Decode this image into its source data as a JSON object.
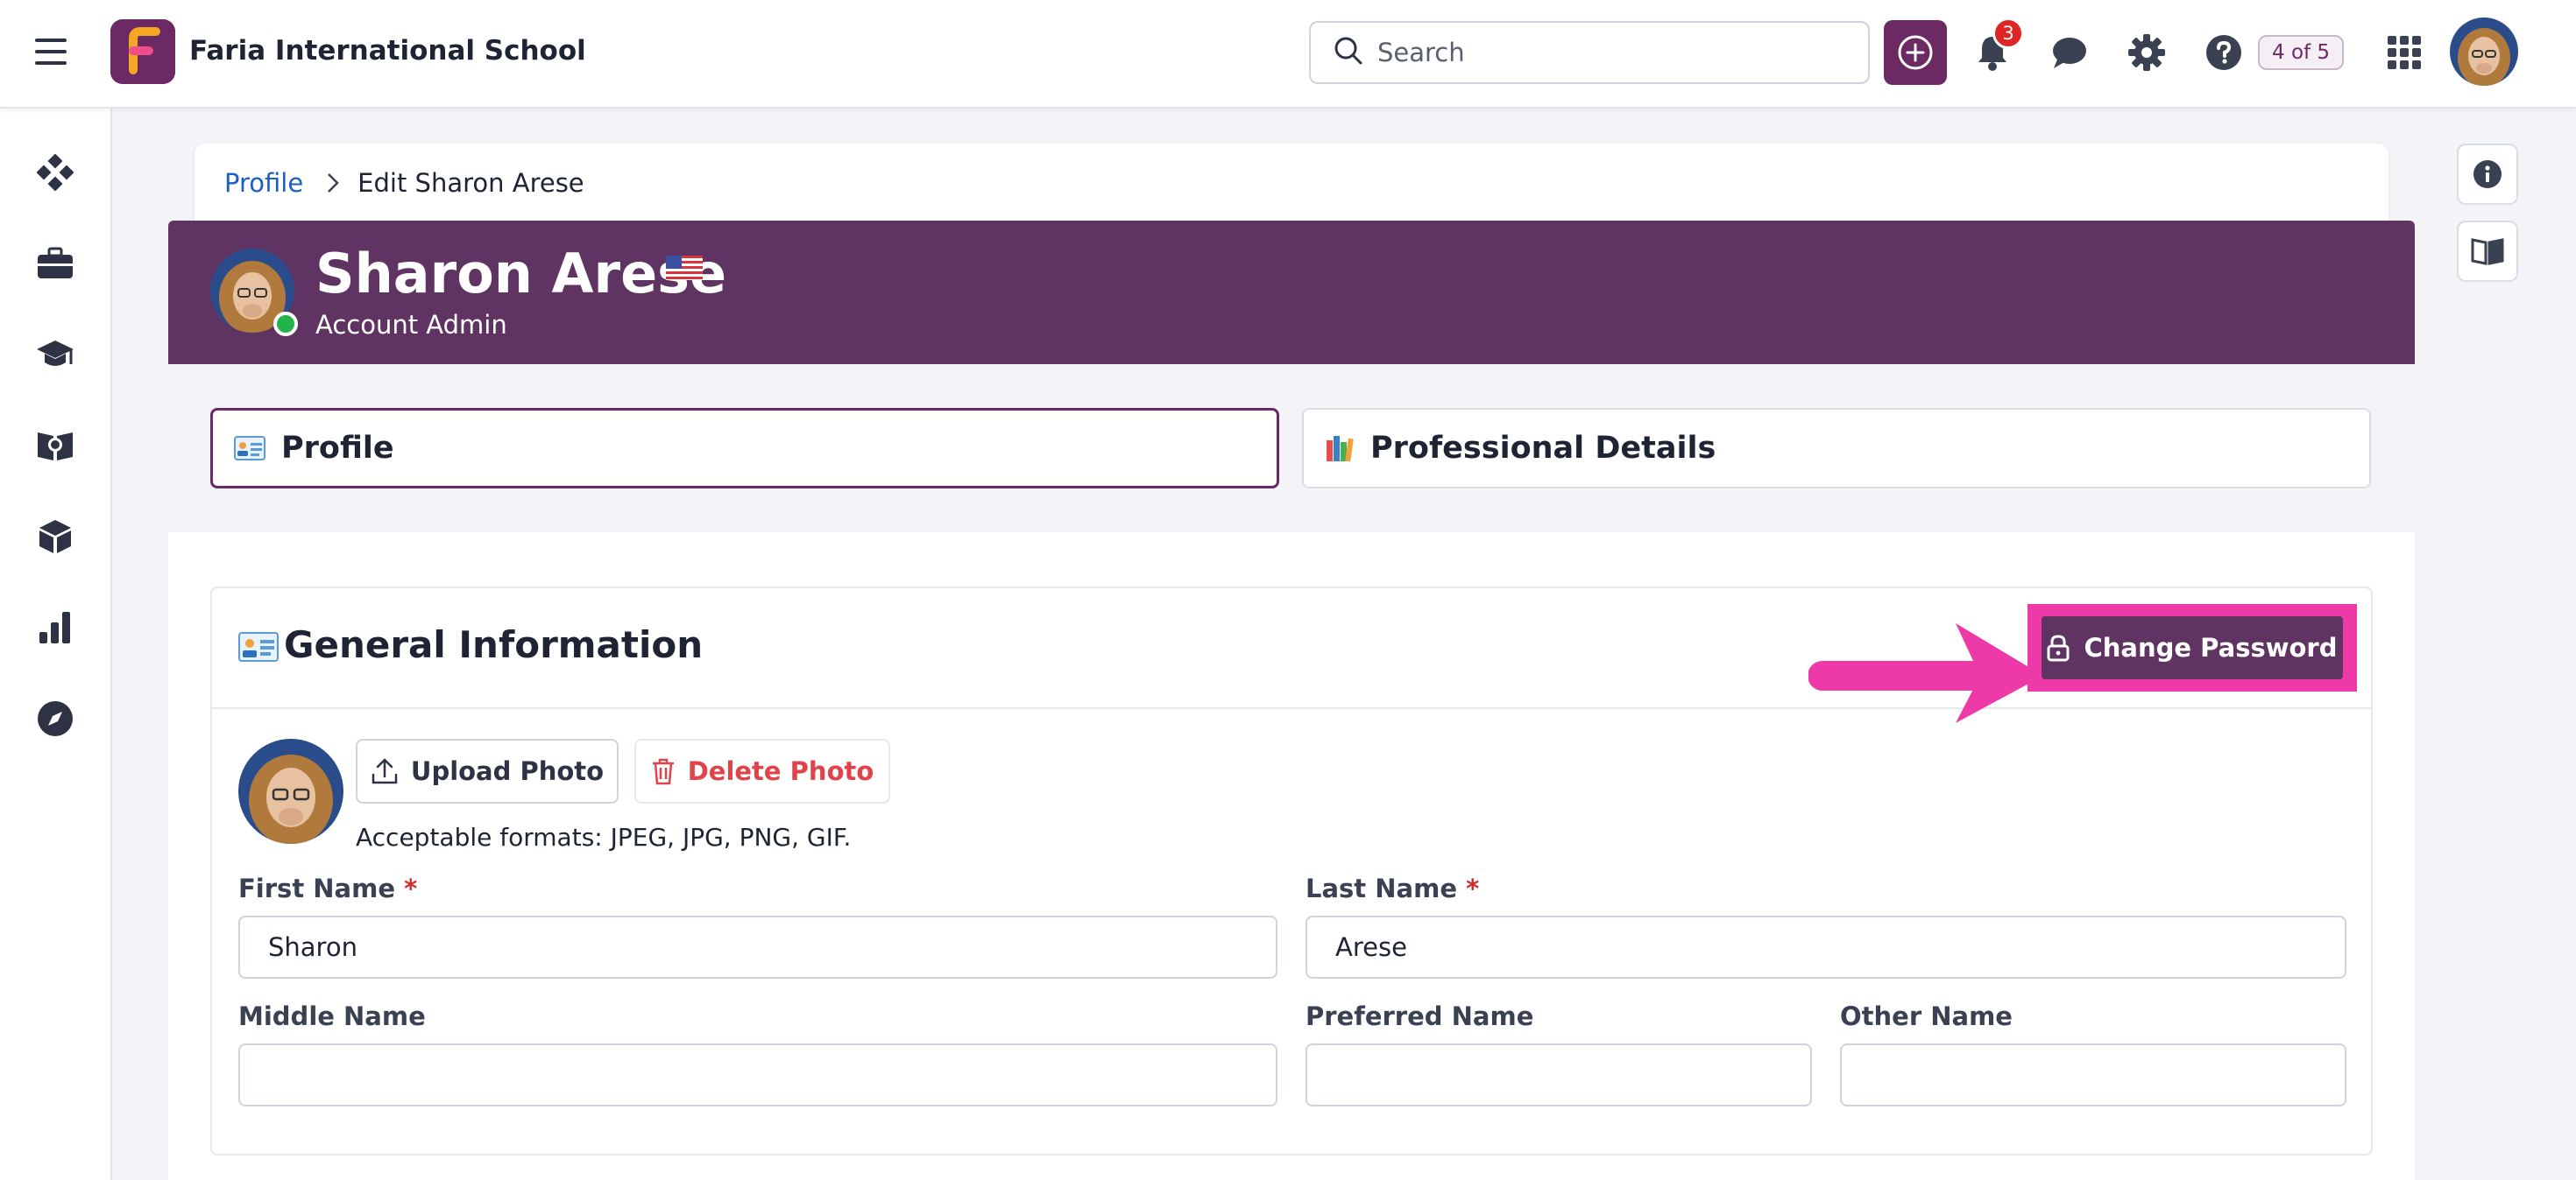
{
  "app": {
    "school_name": "Faria International School",
    "logo_letter": "F"
  },
  "topbar": {
    "search_placeholder": "Search",
    "notification_count": "3",
    "step_progress": "4 of 5"
  },
  "breadcrumb": {
    "parent": "Profile",
    "current": "Edit Sharon Arese"
  },
  "banner": {
    "name": "Sharon Arese",
    "role": "Account Admin"
  },
  "tabs": [
    {
      "label": "Profile",
      "active": true
    },
    {
      "label": "Professional Details",
      "active": false
    }
  ],
  "general_info": {
    "title": "General Information",
    "change_password_label": "Change Password",
    "upload_photo_label": "Upload Photo",
    "delete_photo_label": "Delete Photo",
    "formats_text": "Acceptable formats: JPEG, JPG, PNG, GIF."
  },
  "form": {
    "first_name": {
      "label": "First Name",
      "required_mark": "*",
      "value": "Sharon"
    },
    "last_name": {
      "label": "Last Name",
      "required_mark": "*",
      "value": "Arese"
    },
    "middle_name": {
      "label": "Middle Name",
      "value": ""
    },
    "preferred_name": {
      "label": "Preferred Name",
      "value": ""
    },
    "other_name": {
      "label": "Other Name",
      "value": ""
    }
  },
  "colors": {
    "brand_purple": "#5f3462",
    "highlight_pink": "#ee3aa8",
    "link_blue": "#1c5fc8",
    "danger_red": "#e0434a"
  }
}
